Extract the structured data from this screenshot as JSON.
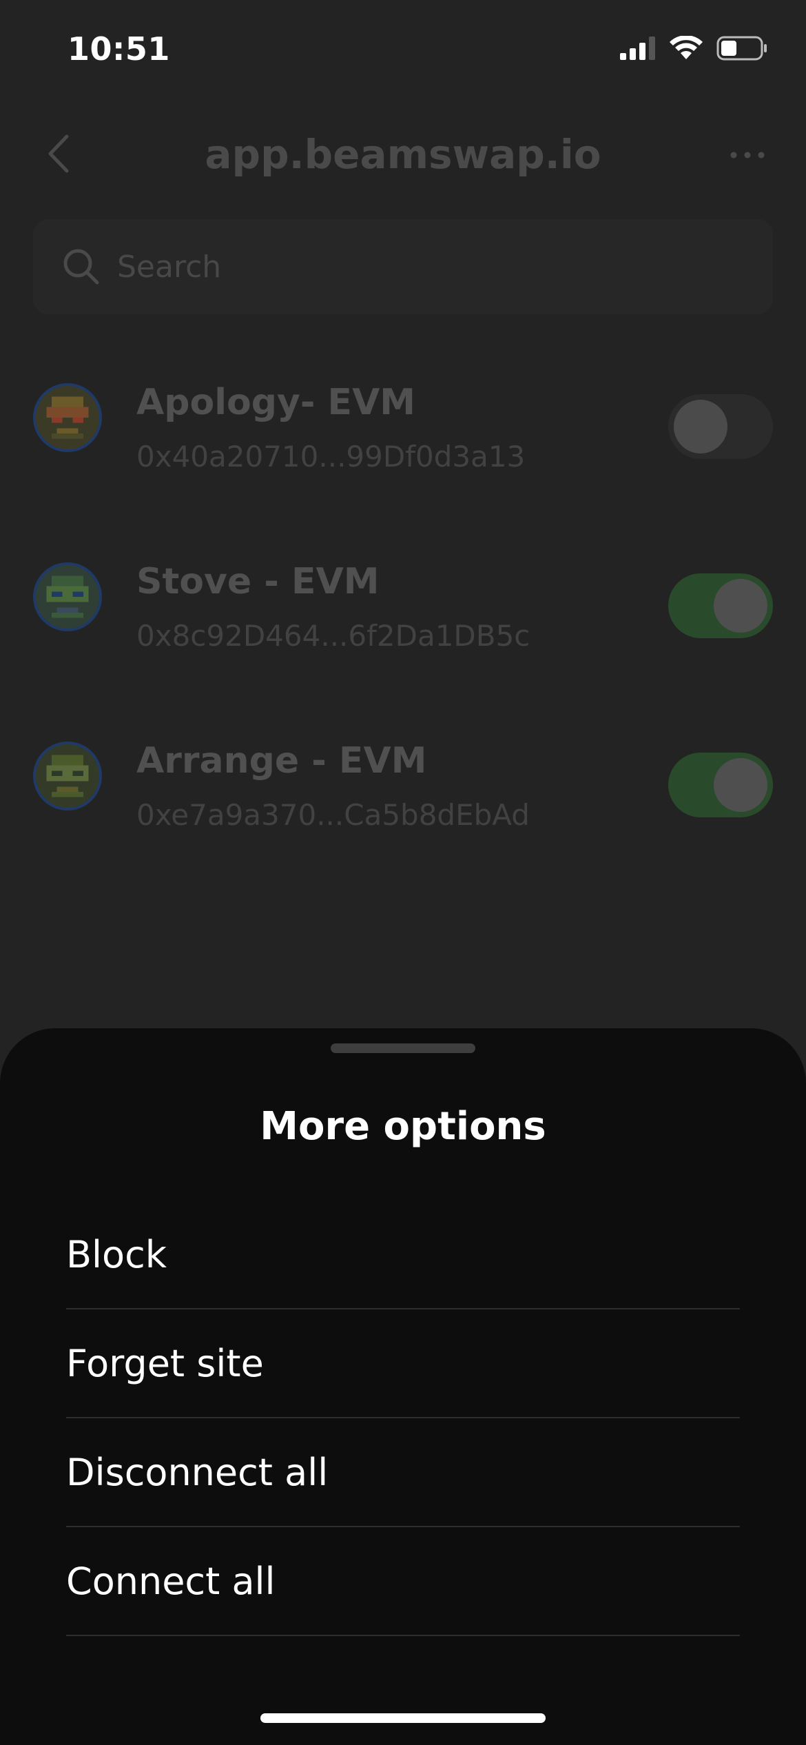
{
  "status_bar": {
    "time": "10:51"
  },
  "header": {
    "title": "app.beamswap.io",
    "back_icon": "chevron-left-icon",
    "more_icon": "ellipsis-icon"
  },
  "search": {
    "placeholder": "Search"
  },
  "accounts": [
    {
      "name": "Apology- EVM",
      "address": "0x40a20710...99Df0d3a13",
      "connected": false
    },
    {
      "name": "Stove - EVM",
      "address": "0x8c92D464...6f2Da1DB5c",
      "connected": true
    },
    {
      "name": "Arrange - EVM",
      "address": "0xe7a9a370...Ca5b8dEbAd",
      "connected": true
    }
  ],
  "sheet": {
    "title": "More options",
    "options": [
      {
        "label": "Block"
      },
      {
        "label": "Forget site"
      },
      {
        "label": "Disconnect all"
      },
      {
        "label": "Connect all"
      }
    ]
  },
  "colors": {
    "toggle_on": "#2a4a2c",
    "sheet_background": "#0d0d0d",
    "avatar_ring": "#1f3a66"
  }
}
